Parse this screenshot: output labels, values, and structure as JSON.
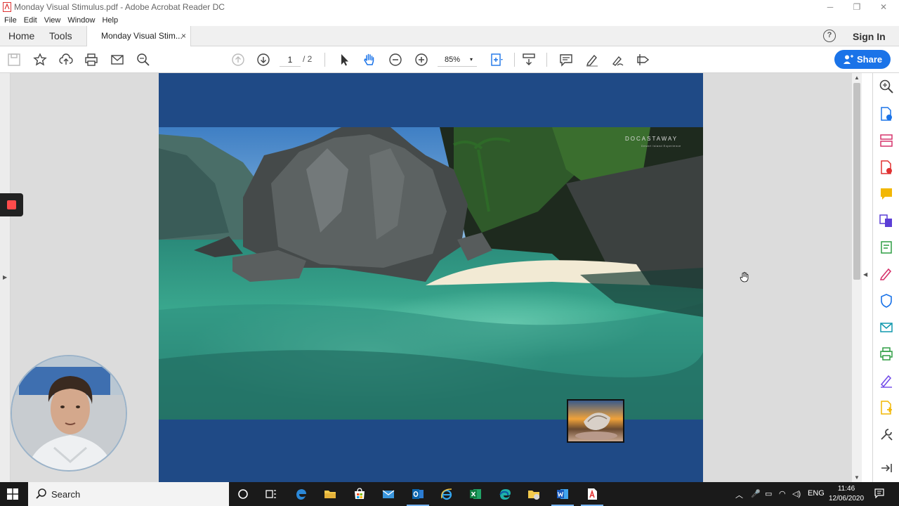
{
  "window": {
    "title": "Monday Visual Stimulus.pdf - Adobe Acrobat Reader DC",
    "minimize": "─",
    "maximize": "❐",
    "close": "✕"
  },
  "menu": [
    "File",
    "Edit",
    "View",
    "Window",
    "Help"
  ],
  "tabs": {
    "home": "Home",
    "tools": "Tools",
    "document": "Monday Visual Stim...",
    "close": "×"
  },
  "header": {
    "help": "?",
    "sign_in": "Sign In",
    "share": "Share"
  },
  "toolbar": {
    "current_page": "1",
    "total_pages": "/ 2",
    "zoom": "85%",
    "zoom_caret": "▾"
  },
  "document": {
    "brand": "DOCASTAWAY",
    "brand_tagline": "Desert Island Experience"
  },
  "taskbar": {
    "search": "Search",
    "language": "ENG",
    "time": "11:46",
    "date": "12/06/2020"
  },
  "colors": {
    "accent": "#1a73e8",
    "page_background": "#1f4a86",
    "recording": "#ff4b4b"
  }
}
